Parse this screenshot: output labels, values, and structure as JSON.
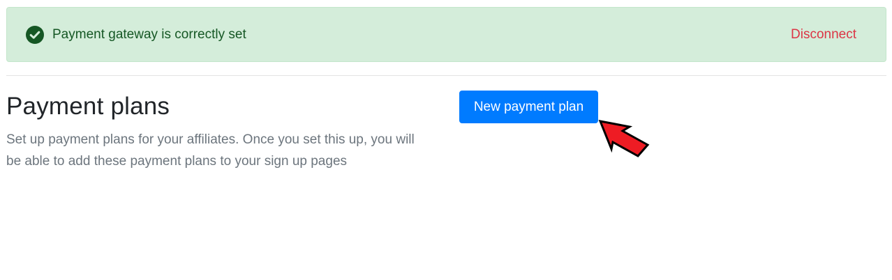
{
  "alert": {
    "icon": "check-circle-icon",
    "message": "Payment gateway is correctly set",
    "action_label": "Disconnect",
    "colors": {
      "background": "#d4edda",
      "text": "#155724",
      "action": "#dc3545"
    }
  },
  "section": {
    "title": "Payment plans",
    "description": "Set up payment plans for your affiliates. Once you set this up, you will be able to add these payment plans to your sign up pages"
  },
  "primary_button": {
    "label": "New payment plan",
    "color": "#007bff"
  },
  "annotation": {
    "icon": "red-arrow-icon",
    "color": "#ee1c24"
  }
}
